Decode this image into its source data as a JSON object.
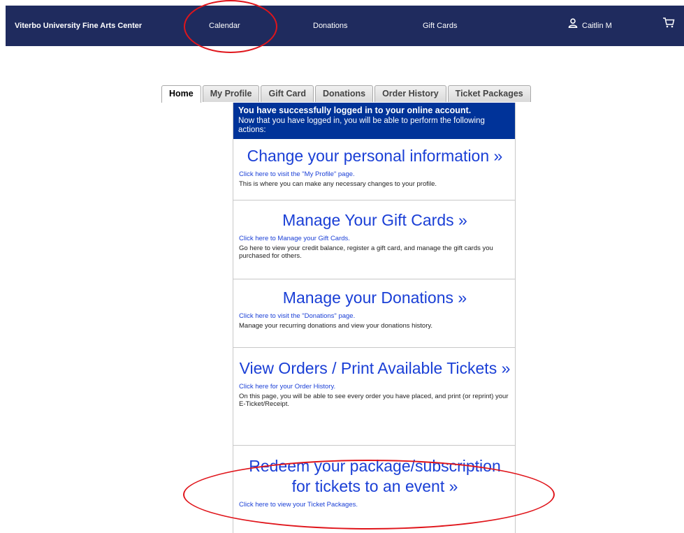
{
  "nav": {
    "brand": "Viterbo University Fine Arts Center",
    "calendar": "Calendar",
    "donations": "Donations",
    "gift_cards": "Gift Cards",
    "user_name": "Caitlin M",
    "icons": {
      "user": "user-icon",
      "cart": "cart-icon"
    }
  },
  "tabs": [
    {
      "label": "Home",
      "active": true
    },
    {
      "label": "My Profile"
    },
    {
      "label": "Gift Card"
    },
    {
      "label": "Donations"
    },
    {
      "label": "Order History"
    },
    {
      "label": "Ticket Packages"
    }
  ],
  "banner": {
    "heading": "You have successfully logged in to your online account.",
    "text": "Now that you have logged in, you will be able to perform the following actions:"
  },
  "sections": [
    {
      "heading": "Change your personal information »",
      "link": "Click here to visit the \"My Profile\" page.",
      "desc": "This is where you can make any necessary changes to your profile."
    },
    {
      "heading": "Manage Your Gift Cards »",
      "link": "Click here to Manage your Gift Cards.",
      "desc": "Go here to view your credit balance, register a gift card, and manage the gift cards you purchased for others."
    },
    {
      "heading": "Manage your Donations »",
      "link": "Click here to visit the \"Donations\" page.",
      "desc": "Manage your recurring donations and view your donations history."
    },
    {
      "heading": "View Orders / Print Available Tickets »",
      "link": "Click here for your Order History.",
      "desc": "On this page, you will be able to see every order you have placed, and print (or reprint) your E-Ticket/Receipt."
    },
    {
      "heading": "Redeem your package/subscription for tickets to an event »",
      "link": "Click here to view your Ticket Packages."
    }
  ],
  "colors": {
    "nav_bg": "#1f2b5e",
    "banner_bg": "#003399",
    "link": "#1a3fd6",
    "annotation": "#e0151b"
  }
}
